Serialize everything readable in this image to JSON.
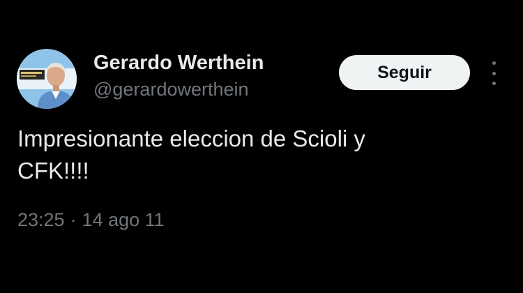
{
  "author": {
    "name": "Gerardo Werthein",
    "handle": "@gerardowerthein",
    "avatar_icon": "profile-photo"
  },
  "actions": {
    "follow_label": "Seguir",
    "more_icon": "more-options-icon"
  },
  "tweet": {
    "text_line1": "Impresionante eleccion de Scioli y",
    "text_line2": "CFK!!!!",
    "time": "23:25",
    "separator": "·",
    "date": "14 ago 11"
  },
  "colors": {
    "background": "#000000",
    "primary_text": "#e7e9ea",
    "secondary_text": "#71767b",
    "follow_button_bg": "#eff3f4",
    "follow_button_text": "#0f1419"
  }
}
